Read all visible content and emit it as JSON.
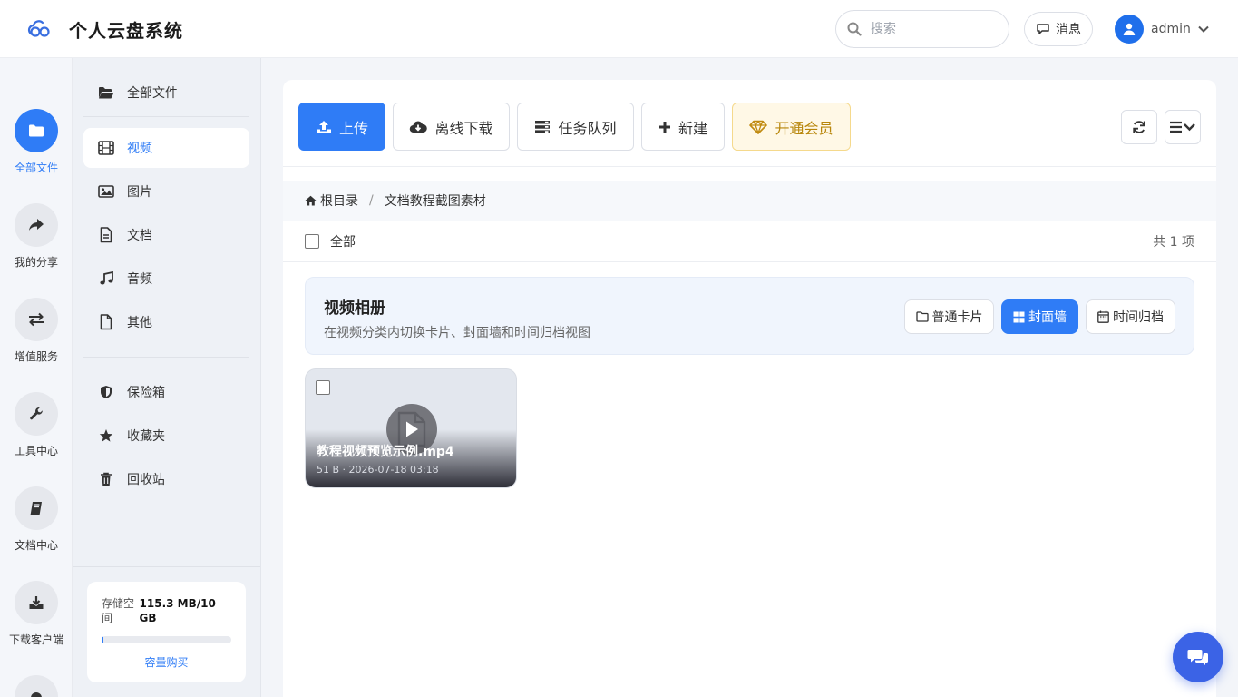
{
  "header": {
    "app_title": "个人云盘系统",
    "search_placeholder": "搜索",
    "messages_label": "消息",
    "user_name": "admin"
  },
  "rail": {
    "items": [
      {
        "label": "全部文件",
        "icon": "folder-icon",
        "active": true
      },
      {
        "label": "我的分享",
        "icon": "share-icon"
      },
      {
        "label": "增值服务",
        "icon": "exchange-icon"
      },
      {
        "label": "工具中心",
        "icon": "wrench-icon"
      },
      {
        "label": "文档中心",
        "icon": "book-icon"
      },
      {
        "label": "下载客户端",
        "icon": "download-icon"
      }
    ]
  },
  "categories": {
    "items": [
      {
        "label": "全部文件",
        "icon": "folder-open-icon"
      },
      {
        "label": "视频",
        "icon": "film-icon",
        "active": true
      },
      {
        "label": "图片",
        "icon": "image-icon"
      },
      {
        "label": "文档",
        "icon": "document-icon"
      },
      {
        "label": "音频",
        "icon": "music-icon"
      },
      {
        "label": "其他",
        "icon": "file-icon"
      },
      {
        "label": "保险箱",
        "icon": "shield-icon"
      },
      {
        "label": "收藏夹",
        "icon": "star-icon"
      },
      {
        "label": "回收站",
        "icon": "trash-icon"
      }
    ]
  },
  "storage": {
    "label": "存储空间",
    "value": "115.3 MB/10 GB",
    "used_fraction": 0.011,
    "buy_label": "容量购买"
  },
  "toolbar": {
    "upload_label": "上传",
    "offline_label": "离线下载",
    "tasks_label": "任务队列",
    "new_label": "新建",
    "vip_label": "开通会员"
  },
  "breadcrumb": {
    "root": "根目录",
    "separator": "/",
    "current": "文档教程截图素材"
  },
  "selection": {
    "all_label": "全部",
    "count_label": "共 1 项"
  },
  "album": {
    "title": "视频相册",
    "description": "在视频分类内切换卡片、封面墙和时间归档视图",
    "views": [
      {
        "label": "普通卡片",
        "icon": "folder-outline-icon"
      },
      {
        "label": "封面墙",
        "icon": "grid-icon",
        "active": true
      },
      {
        "label": "时间归档",
        "icon": "calendar-icon"
      }
    ]
  },
  "file": {
    "name": "教程视频预览示例.mp4",
    "meta": "51 B · 2026-07-18 03:18"
  },
  "colors": {
    "accent": "#2f7cf6",
    "vip": "#b8860b",
    "fab": "#3b63e6"
  }
}
